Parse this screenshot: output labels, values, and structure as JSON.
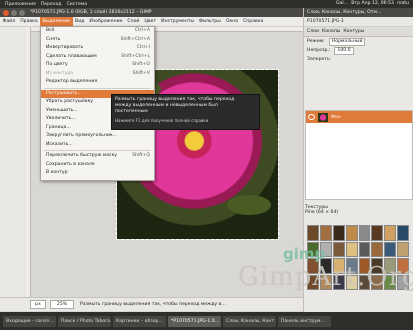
{
  "topbar": {
    "menus": [
      "Приложения",
      "Переход",
      "Система"
    ],
    "apps_count": "1",
    "tray": [
      "Gal…",
      "Втр Апр 12, 06:53",
      "matu"
    ]
  },
  "window": {
    "title": "*P1070571.JPG-1.0 (RGB, 1 слой) 2816x2112 – GIMP"
  },
  "menubar": {
    "items": [
      "Файл",
      "Правка",
      "Выделение",
      "Вид",
      "Изображение",
      "Слой",
      "Цвет",
      "Инструменты",
      "Фильтры",
      "Окна",
      "Справка"
    ],
    "active_index": 2
  },
  "selection_menu": {
    "items": [
      {
        "label": "Всё",
        "shortcut": "Ctrl+A",
        "disabled": false
      },
      {
        "label": "Снять",
        "shortcut": "Shift+Ctrl+A",
        "disabled": false
      },
      {
        "label": "Инвертировать",
        "shortcut": "Ctrl+I",
        "disabled": false
      },
      {
        "label": "Сделать плавающим",
        "shortcut": "Shift+Ctrl+L",
        "disabled": false
      },
      {
        "label": "По цвету",
        "shortcut": "Shift+O",
        "disabled": false
      },
      {
        "label": "Из контура",
        "shortcut": "Shift+V",
        "disabled": true
      },
      {
        "label": "Редактор выделения",
        "shortcut": "",
        "disabled": false
      },
      {
        "label": "Растушевать...",
        "shortcut": "",
        "disabled": false,
        "highlighted": true
      },
      {
        "label": "Убрать растушёвку",
        "shortcut": "",
        "disabled": false
      },
      {
        "label": "Уменьшить...",
        "shortcut": "",
        "disabled": false
      },
      {
        "label": "Увеличить...",
        "shortcut": "",
        "disabled": false
      },
      {
        "label": "Граница...",
        "shortcut": "",
        "disabled": false
      },
      {
        "label": "Закруглить прямоугольник...",
        "shortcut": "",
        "disabled": false
      },
      {
        "label": "Исказить...",
        "shortcut": "",
        "disabled": false
      },
      {
        "label": "Переключить быструю маску",
        "shortcut": "Shift+Q",
        "disabled": false
      },
      {
        "label": "Сохранить в канале",
        "shortcut": "",
        "disabled": false
      },
      {
        "label": "В контур",
        "shortcut": "",
        "disabled": false
      }
    ]
  },
  "tooltip": {
    "lines": [
      "Размыть границу выделения так, чтобы переход",
      "между выделенным и невыделенным был",
      "постепенным"
    ],
    "hint": "Нажмите F1 для получения полной справки"
  },
  "statusbar": {
    "unit": "px",
    "zoom": "25%",
    "message": "Размыть границу выделения так, чтобы переход между в…"
  },
  "panel": {
    "title": "Слои, Каналы, Контуры, Отм…",
    "image_name": "P1070571.JPG-1",
    "tabs": [
      "Слои",
      "Каналы",
      "Контуры"
    ],
    "mode_label": "Режим:",
    "mode_value": "Нормальный",
    "opacity_label": "Непрозр.:",
    "opacity_value": "100.0",
    "lock_label": "Запереть:",
    "layer_name": "Фон",
    "patterns_title": "Текстуры",
    "pattern_name": "Pine (64 × 64)"
  },
  "taskbar": {
    "items": [
      {
        "label": "Входящие - carvin…",
        "active": false
      },
      {
        "label": "Поиск / Photo Tabora…",
        "active": false
      },
      {
        "label": "Картинки – обзор…",
        "active": false
      },
      {
        "label": "*P1070571.JPG-1.0…",
        "active": true
      },
      {
        "label": "Слои, Каналы, Конт…",
        "active": false
      },
      {
        "label": "Панель инструм…",
        "active": false
      }
    ]
  },
  "watermark": {
    "logo": "gimp",
    "site": "GimpArt.Org"
  },
  "colors": {
    "accent": "#e07a3a",
    "dark_bar": "#2f2e2b"
  }
}
